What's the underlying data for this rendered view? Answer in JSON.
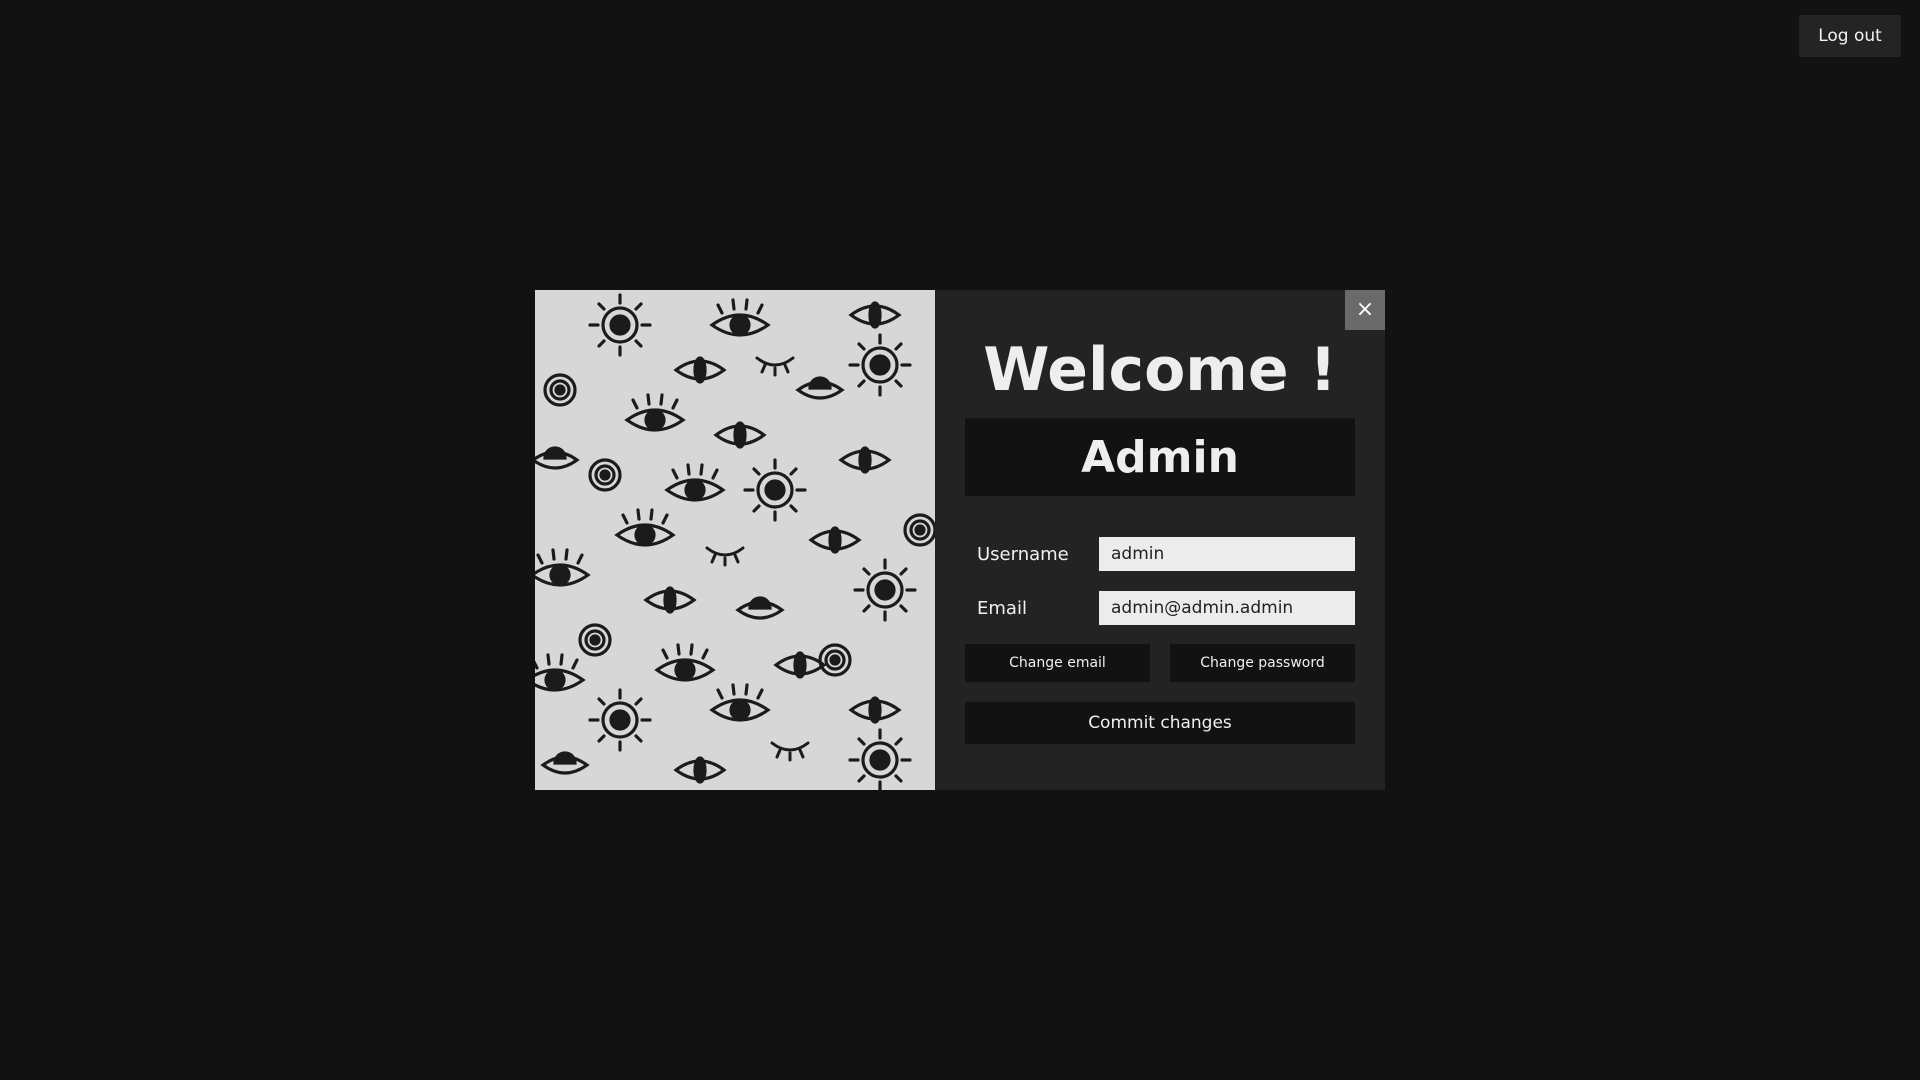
{
  "header": {
    "logout_label": "Log out"
  },
  "modal": {
    "close_glyph": "×",
    "title": "Welcome !",
    "user_display_name": "Admin",
    "fields": {
      "username_label": "Username",
      "username_value": "admin",
      "email_label": "Email",
      "email_value": "admin@admin.admin"
    },
    "buttons": {
      "change_email": "Change email",
      "change_password": "Change password",
      "commit": "Commit changes"
    },
    "side_art": "eye-pattern-illustration"
  },
  "colors": {
    "page_background": "#121212",
    "panel_background": "#232323",
    "close_button": "#6a6a6a",
    "pattern_background": "#d7d7d7",
    "pattern_ink": "#1b1b1b"
  }
}
